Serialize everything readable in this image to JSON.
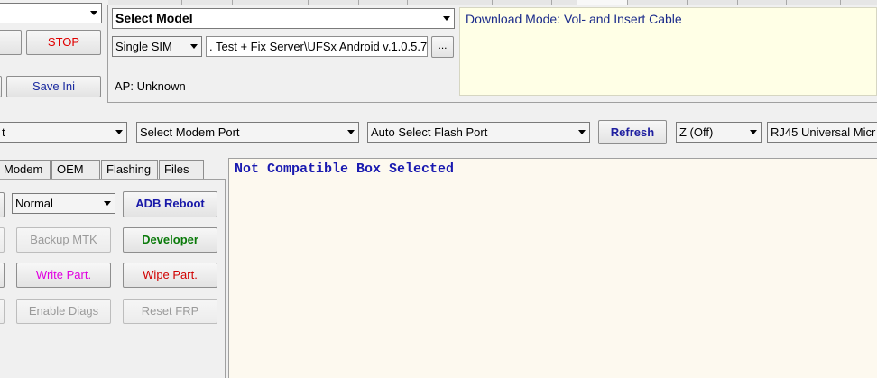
{
  "top_left": {
    "stop_label": "STOP",
    "save_ini_label": "Save Ini"
  },
  "model": {
    "select_model_label": "Select Model",
    "sim_select_value": "Single SIM",
    "path_field_value": ". Test + Fix Server\\UFSx Android v.1.0.5.7",
    "browse_label": "...",
    "ap_status": "AP: Unknown"
  },
  "info": {
    "download_mode_text": "Download Mode: Vol- and Insert Cable"
  },
  "ports": {
    "left_combo_value": "t",
    "modem_port_value": "Select Modem Port",
    "flash_port_value": "Auto Select Flash Port",
    "refresh_label": "Refresh",
    "z_combo_value": "Z (Off)",
    "rj45_combo_value": "RJ45 Universal Micr"
  },
  "tabs": [
    {
      "label": "Modem"
    },
    {
      "label": "OEM"
    },
    {
      "label": "Flashing"
    },
    {
      "label": "Files"
    }
  ],
  "actions": {
    "mode_combo_value": "Normal",
    "adb_reboot_label": "ADB Reboot",
    "backup_mtk_label": "Backup MTK",
    "developer_label": "Developer",
    "write_part_label": "Write Part.",
    "wipe_part_label": "Wipe Part.",
    "enable_diags_label": "Enable Diags",
    "reset_frp_label": "Reset FRP"
  },
  "log": {
    "message": "Not Compatible Box Selected"
  },
  "colors": {
    "log_text": "#1a1ab0",
    "stop_text": "#e00000",
    "developer_text": "#0a7a0a",
    "write_part_text": "#e000e0",
    "wipe_part_text": "#d00000",
    "info_background": "#ffffe6",
    "log_background": "#fdf9ef"
  }
}
